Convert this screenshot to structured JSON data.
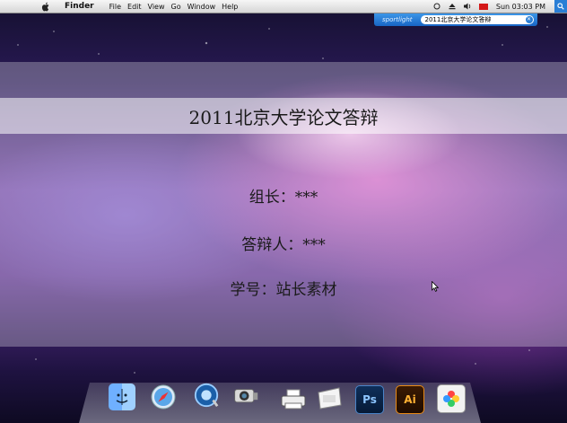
{
  "menubar": {
    "app_name": "Finder",
    "items": [
      "File",
      "Edit",
      "View",
      "Go",
      "Window",
      "Help"
    ],
    "clock": "Sun 03:03 PM"
  },
  "spotlight": {
    "label": "sportlight",
    "query": "2011北京大学论文答辩"
  },
  "slide": {
    "title": "2011北京大学论文答辩",
    "lines": [
      "组长：***",
      "答辩人：***",
      "学号：站长素材"
    ]
  },
  "dock": {
    "icons": [
      "finder-icon",
      "safari-icon",
      "quicktime-icon",
      "camera-icon",
      "printer-icon",
      "preview-icon",
      "photoshop-icon",
      "illustrator-icon",
      "iphoto-icon"
    ],
    "ps_label": "Ps",
    "ai_label": "Ai"
  }
}
